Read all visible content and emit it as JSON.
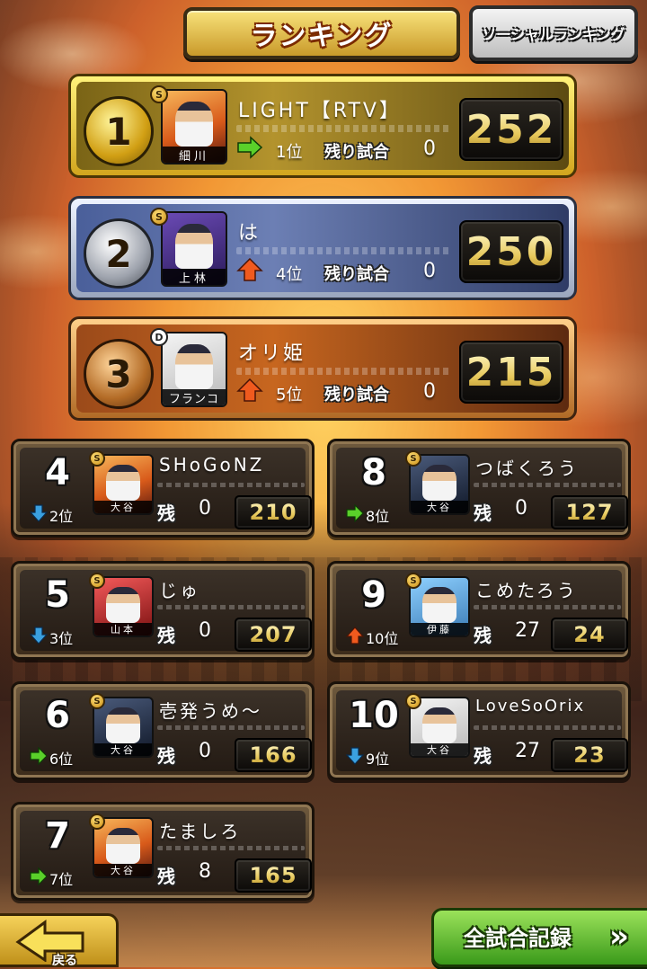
{
  "header": {
    "tab_ranking": "ランキング",
    "tab_social": "ソーシャルランキング"
  },
  "labels": {
    "remaining_games_long": "残り試合",
    "remaining_games_short": "残"
  },
  "top3": [
    {
      "rank": "1",
      "player": "LIGHT【RTV】",
      "avatar_name": "細川",
      "badge": "S",
      "trend": "same",
      "prev_rank": "1位",
      "remaining": "0",
      "score": "252"
    },
    {
      "rank": "2",
      "player": "は",
      "avatar_name": "上林",
      "badge": "S",
      "trend": "up",
      "prev_rank": "4位",
      "remaining": "0",
      "score": "250"
    },
    {
      "rank": "3",
      "player": "オリ姫",
      "avatar_name": "フランコ",
      "badge": "D",
      "trend": "up",
      "prev_rank": "5位",
      "remaining": "0",
      "score": "215"
    }
  ],
  "others": [
    {
      "rank": "4",
      "player": "SHoGoNZ",
      "avatar_name": "大谷",
      "trend": "down",
      "prev_rank": "2位",
      "remaining": "0",
      "score": "210"
    },
    {
      "rank": "5",
      "player": "じゅ",
      "avatar_name": "山本",
      "trend": "down",
      "prev_rank": "3位",
      "remaining": "0",
      "score": "207"
    },
    {
      "rank": "6",
      "player": "壱発うめ〜",
      "avatar_name": "大谷",
      "trend": "same",
      "prev_rank": "6位",
      "remaining": "0",
      "score": "166"
    },
    {
      "rank": "7",
      "player": "たましろ",
      "avatar_name": "大谷",
      "trend": "same",
      "prev_rank": "7位",
      "remaining": "8",
      "score": "165"
    },
    {
      "rank": "8",
      "player": "つばくろう",
      "avatar_name": "大谷",
      "trend": "same",
      "prev_rank": "8位",
      "remaining": "0",
      "score": "127"
    },
    {
      "rank": "9",
      "player": "こめたろう",
      "avatar_name": "伊藤",
      "trend": "up",
      "prev_rank": "10位",
      "remaining": "27",
      "score": "24"
    },
    {
      "rank": "10",
      "player": "LoveSoOrix",
      "avatar_name": "大谷",
      "trend": "down",
      "prev_rank": "9位",
      "remaining": "27",
      "score": "23"
    }
  ],
  "footer": {
    "back_label": "戻る",
    "records_label": "全試合記録",
    "records_chevron": "»"
  },
  "colors": {
    "trend_up": "#f05a1e",
    "trend_down": "#3aa0e0",
    "trend_same": "#5ad02a"
  }
}
